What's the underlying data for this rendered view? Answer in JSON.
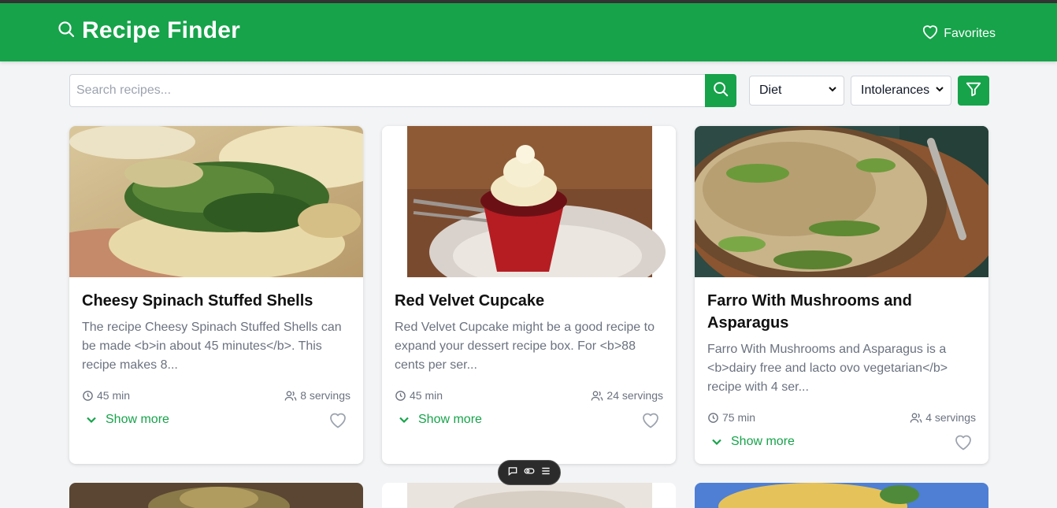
{
  "app": {
    "title": "Recipe Finder",
    "favorites_label": "Favorites",
    "accent": "#16a34a"
  },
  "search": {
    "placeholder": "Search recipes...",
    "diet_selected": "Diet",
    "intolerances_selected": "Intolerances"
  },
  "recipes": [
    {
      "title": "Cheesy Spinach Stuffed Shells",
      "description": "The recipe Cheesy Spinach Stuffed Shells can be made <b>in about 45 minutes</b>. This recipe makes 8...",
      "time": "45 min",
      "servings": "8 servings",
      "show_more": "Show more"
    },
    {
      "title": "Red Velvet Cupcake",
      "description": "Red Velvet Cupcake might be a good recipe to expand your dessert recipe box. For <b>88 cents per ser...",
      "time": "45 min",
      "servings": "24 servings",
      "show_more": "Show more"
    },
    {
      "title": "Farro With Mushrooms and Asparagus",
      "description": "Farro With Mushrooms and Asparagus is a <b>dairy free and lacto ovo vegetarian</b> recipe with 4 ser...",
      "time": "75 min",
      "servings": "4 servings",
      "show_more": "Show more"
    }
  ]
}
